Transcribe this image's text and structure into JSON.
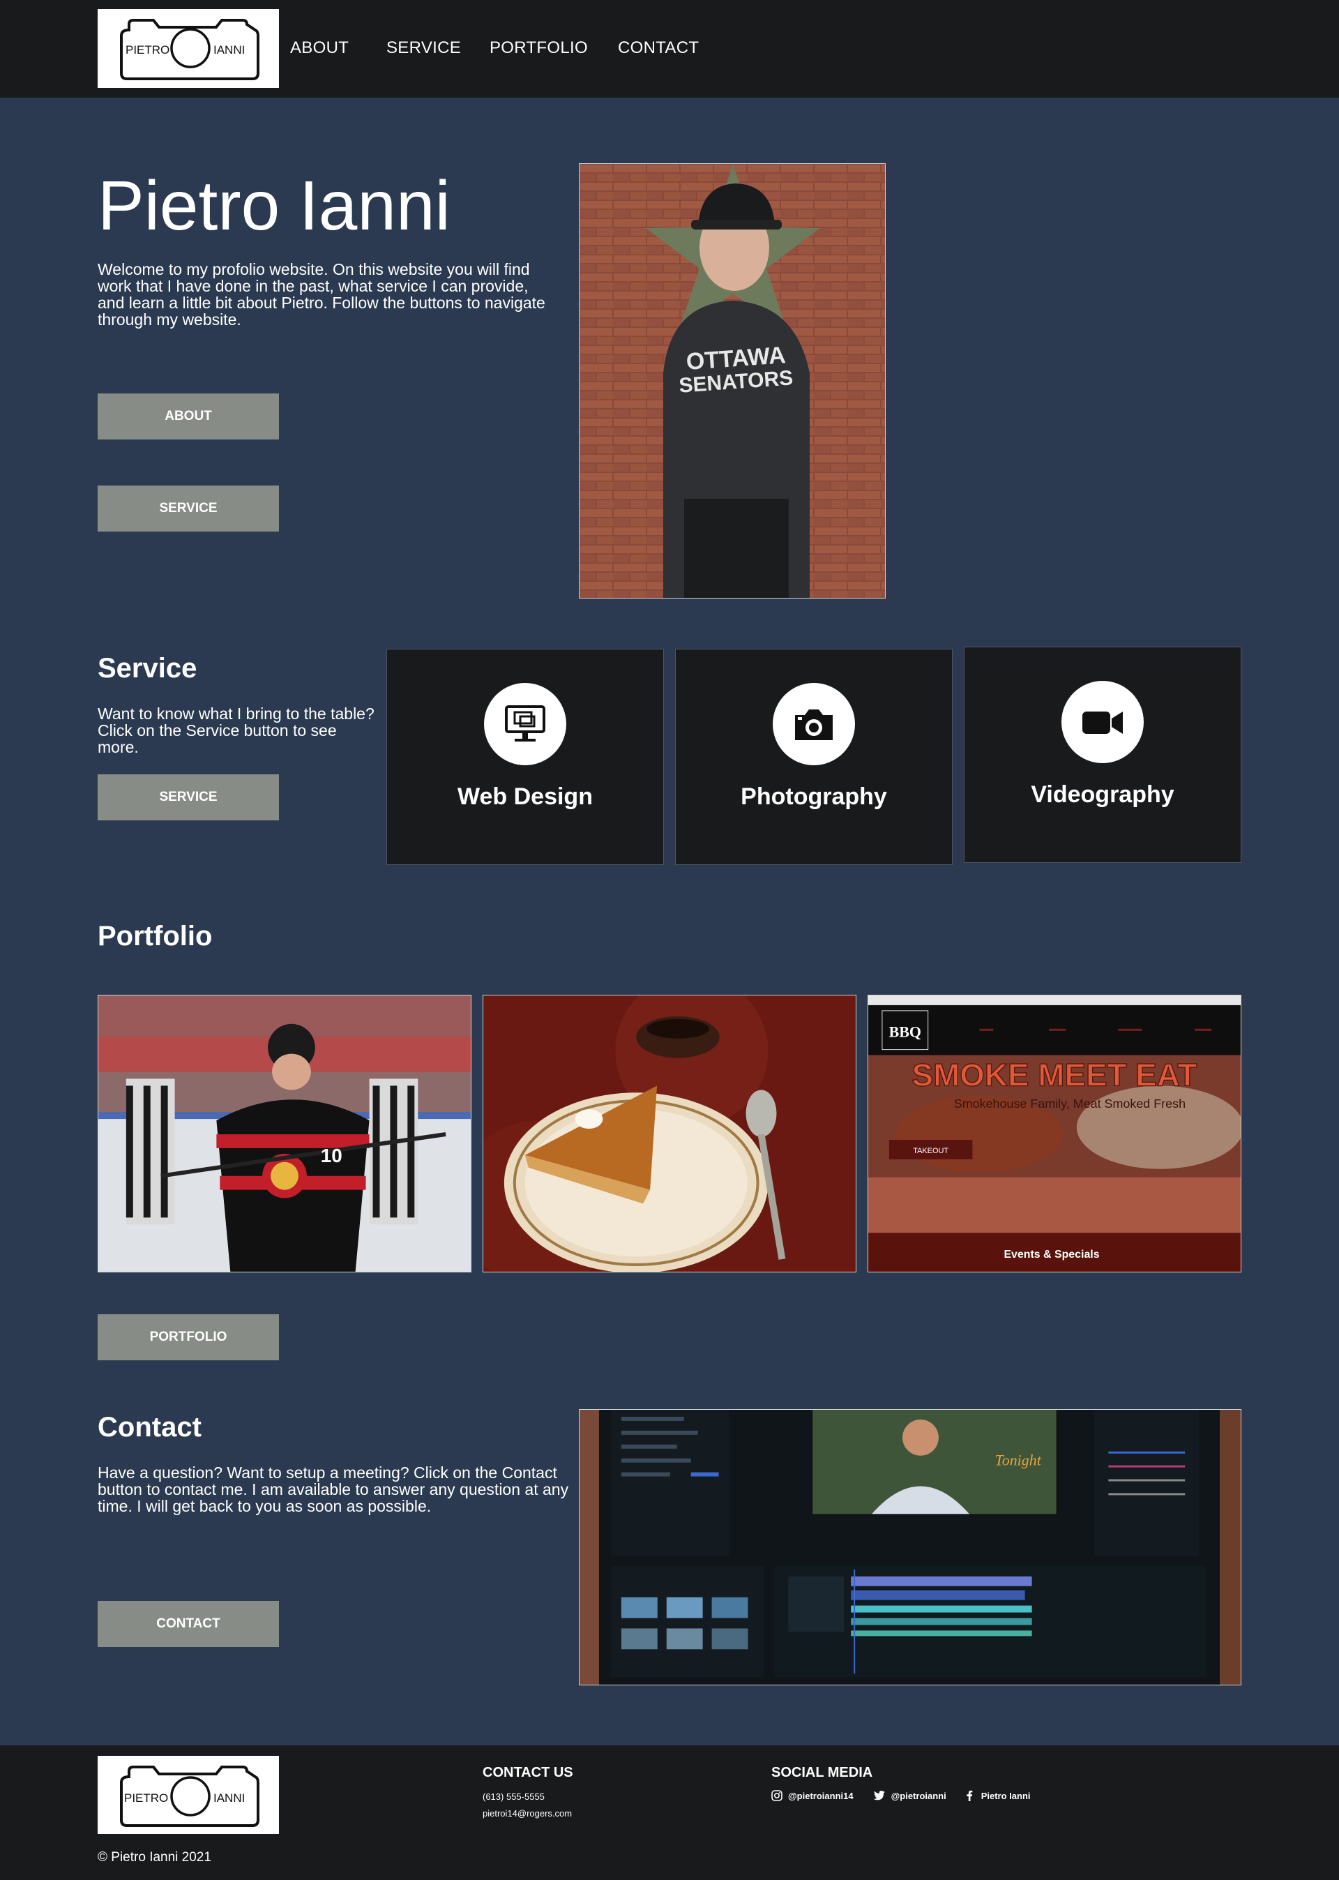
{
  "header": {
    "logo": {
      "left": "PIETRO",
      "right": "IANNI"
    },
    "nav": [
      "ABOUT",
      "SERVICE",
      "PORTFOLIO",
      "CONTACT"
    ]
  },
  "hero": {
    "title": "Pietro Ianni",
    "text": "Welcome to my profolio website. On this website you will find work that I have done in the past, what service I can provide, and learn a little bit about Pietro. Follow the buttons to navigate through my website.",
    "buttons": [
      "ABOUT",
      "SERVICE"
    ],
    "photo": {
      "hoodie_line1": "OTTAWA",
      "hoodie_line2": "SENATORS"
    }
  },
  "service": {
    "title": "Service",
    "text": "Want to know what I bring to the table? Click on the Service button to see more.",
    "button": "SERVICE",
    "cards": [
      {
        "label": "Web Design",
        "icon": "monitor-icon"
      },
      {
        "label": "Photography",
        "icon": "camera-icon"
      },
      {
        "label": "Videography",
        "icon": "video-camera-icon"
      }
    ]
  },
  "portfolio": {
    "title": "Portfolio",
    "button": "PORTFOLIO",
    "items": [
      {
        "name": "hockey-photo",
        "jersey_number": "10"
      },
      {
        "name": "pie-photo"
      },
      {
        "name": "bbq-website",
        "logo": "BBQ",
        "headline": "SMOKE MEET EAT",
        "subheadline": "Smokehouse Family, Meat Smoked Fresh",
        "takeout": "TAKEOUT",
        "events": "Events & Specials"
      }
    ]
  },
  "contact": {
    "title": "Contact",
    "text": "Have a question? Want to setup a meeting? Click on the Contact button to contact me. I am available to answer any question at any time. I will get back to you as soon as possible.",
    "button": "CONTACT",
    "image_caption": "Tonight"
  },
  "footer": {
    "logo": {
      "left": "PIETRO",
      "right": "IANNI"
    },
    "contact_heading": "CONTACT US",
    "phone": "(613) 555-5555",
    "email": "pietroi14@rogers.com",
    "social_heading": "SOCIAL MEDIA",
    "instagram": "@pietroianni14",
    "twitter": "@pietroianni",
    "facebook": "Pietro Ianni",
    "copyright": "© Pietro Ianni 2021"
  },
  "colors": {
    "page_bg": "#2b3a50",
    "header_bg": "#181a1b",
    "button_bg": "#878c86",
    "card_bg": "#181a1b"
  }
}
